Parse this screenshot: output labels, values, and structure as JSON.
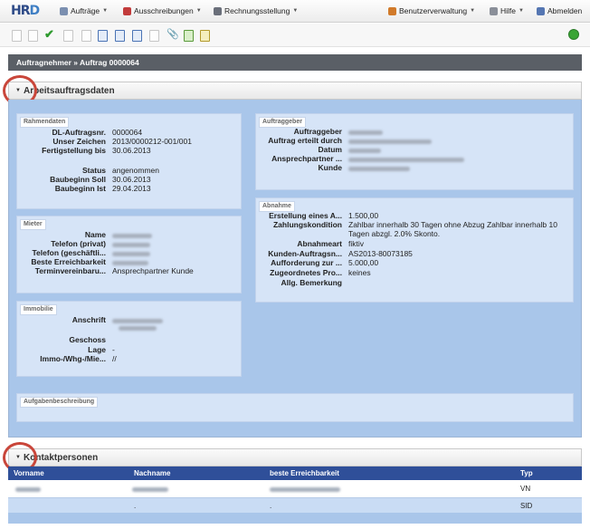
{
  "app": {
    "logo_main": "HR",
    "logo_accent": "D"
  },
  "nav": {
    "items": [
      {
        "label": "Aufträge",
        "icon": "orders-icon",
        "color": "#7b8fb0"
      },
      {
        "label": "Ausschreibungen",
        "icon": "tender-icon",
        "color": "#c23b3b"
      },
      {
        "label": "Rechnungsstellung",
        "icon": "invoice-icon",
        "color": "#6a6f7a"
      },
      {
        "label": "Benutzerverwaltung",
        "icon": "users-icon",
        "color": "#d17a2a"
      },
      {
        "label": "Hilfe",
        "icon": "help-icon",
        "color": "#8a8f99"
      },
      {
        "label": "Abmelden",
        "icon": "logout-icon",
        "color": "#5576b2"
      }
    ]
  },
  "breadcrumb": "Auftragnehmer » Auftrag 0000064",
  "section1": {
    "title": "Arbeitsauftragsdaten",
    "rahmendaten": {
      "title": "Rahmendaten",
      "rows": [
        {
          "label": "DL-Auftragsnr.",
          "value": "0000064"
        },
        {
          "label": "Unser Zeichen",
          "value": "2013/0000212-001/001"
        },
        {
          "label": "Fertigstellung bis",
          "value": "30.06.2013"
        },
        {
          "label": "Status",
          "value": "angenommen"
        },
        {
          "label": "Baubeginn Soll",
          "value": "30.06.2013"
        },
        {
          "label": "Baubeginn Ist",
          "value": "29.04.2013"
        }
      ]
    },
    "auftraggeber": {
      "title": "Auftraggeber",
      "rows": [
        {
          "label": "Auftraggeber"
        },
        {
          "label": "Auftrag erteilt durch"
        },
        {
          "label": "Datum"
        },
        {
          "label": "Ansprechpartner ..."
        },
        {
          "label": "Kunde"
        }
      ]
    },
    "mieter": {
      "title": "Mieter",
      "rows": [
        {
          "label": "Name",
          "value": ""
        },
        {
          "label": "Telefon (privat)",
          "value": ""
        },
        {
          "label": "Telefon (geschäftli...",
          "value": ""
        },
        {
          "label": "Beste Erreichbarkeit",
          "value": ""
        },
        {
          "label": "Terminvereinbaru...",
          "value": "Ansprechpartner Kunde"
        }
      ]
    },
    "abnahme": {
      "title": "Abnahme",
      "rows": [
        {
          "label": "Erstellung eines A...",
          "value": "1.500,00"
        },
        {
          "label": "Zahlungskondition",
          "value": "Zahlbar innerhalb 30 Tagen ohne Abzug Zahlbar innerhalb 10"
        },
        {
          "label": "",
          "value": "Tagen abzgl. 2.0% Skonto."
        },
        {
          "label": "Abnahmeart",
          "value": "fiktiv"
        },
        {
          "label": "Kunden-Auftragsn...",
          "value": "AS2013-80073185"
        },
        {
          "label": "Aufforderung zur ...",
          "value": "5.000,00"
        },
        {
          "label": "Zugeordnetes Pro...",
          "value": "keines"
        },
        {
          "label": "Allg. Bemerkung",
          "value": ""
        }
      ]
    },
    "immobilie": {
      "title": "Immobilie",
      "rows": [
        {
          "label": "Anschrift",
          "value": ""
        },
        {
          "label": "Geschoss",
          "value": ""
        },
        {
          "label": "Lage",
          "value": "-"
        },
        {
          "label": "Immo-/Whg-/Mie...",
          "value": "//"
        }
      ]
    },
    "aufgabe": {
      "title": "Aufgabenbeschreibung"
    }
  },
  "section2": {
    "title": "Kontaktpersonen",
    "columns": [
      "Vorname",
      "Nachname",
      "beste Erreichbarkeit",
      "Typ"
    ],
    "rows": [
      {
        "nachname": "",
        "erreichbarkeit": "",
        "typ": "VN"
      },
      {
        "nachname": ".",
        "erreichbarkeit": ".",
        "typ": "SID"
      }
    ]
  },
  "colors": {
    "accent": "#2f4f99",
    "panel_bg": "#a9c6ea",
    "highlight": "#c9463a"
  }
}
